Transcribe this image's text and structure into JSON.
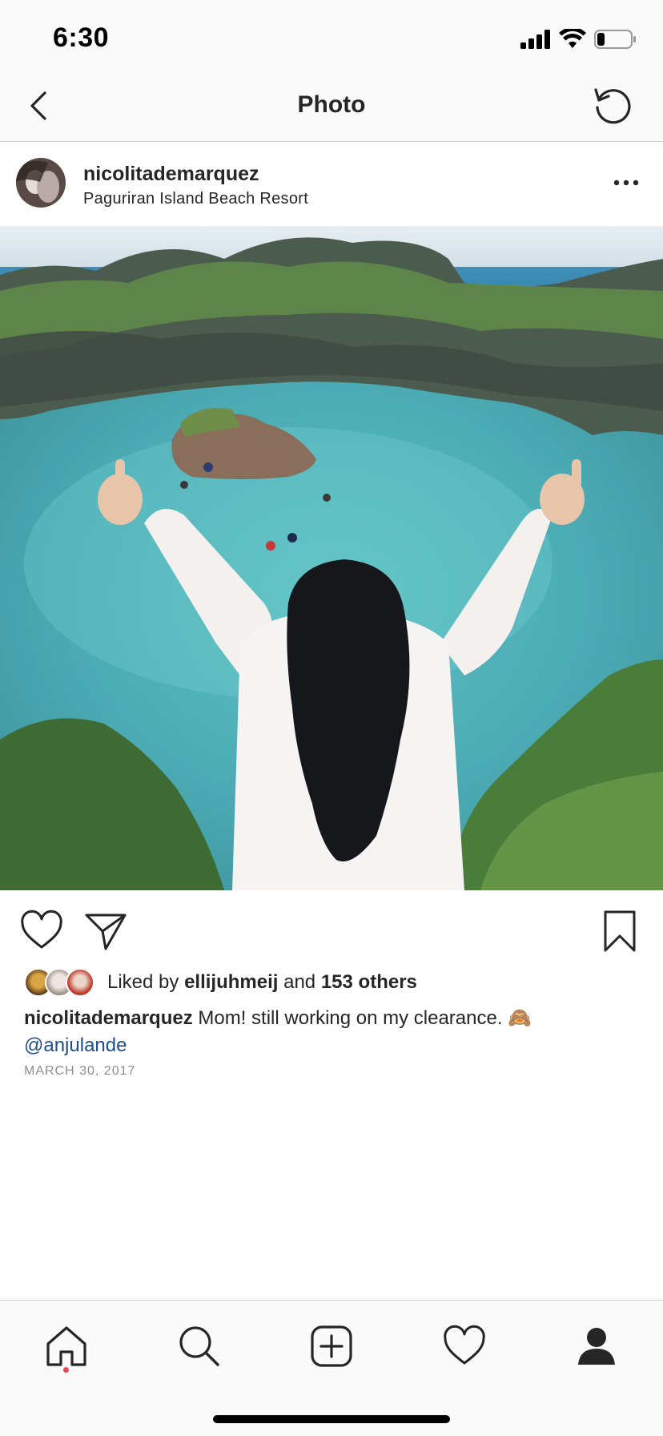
{
  "status_bar": {
    "time": "6:30",
    "icons": [
      "cellular-signal-icon",
      "wifi-icon",
      "battery-icon"
    ]
  },
  "nav": {
    "title": "Photo",
    "back_icon": "chevron-left-icon",
    "refresh_icon": "refresh-icon"
  },
  "post": {
    "username": "nicolitademarquez",
    "location": "Paguriran Island Beach Resort",
    "more_icon": "more-horizontal-icon",
    "likes": {
      "prefix": "Liked by",
      "liker": "ellijuhmeij",
      "joiner": "and",
      "others": "153 others"
    },
    "caption": {
      "author": "nicolitademarquez",
      "text": "Mom! still working on my clearance. 🙈",
      "mention": "@anjulande"
    },
    "date": "MARCH 30, 2017"
  },
  "actions": {
    "like_icon": "heart-icon",
    "share_icon": "paper-plane-icon",
    "save_icon": "bookmark-icon"
  },
  "tab_bar": {
    "items": [
      "home-icon",
      "search-icon",
      "add-post-icon",
      "activity-heart-icon",
      "profile-icon"
    ],
    "active": "home-icon"
  },
  "colors": {
    "mention": "#1f4e8c",
    "notification_dot": "#ed4956",
    "muted_text": "#8e8e8e"
  }
}
